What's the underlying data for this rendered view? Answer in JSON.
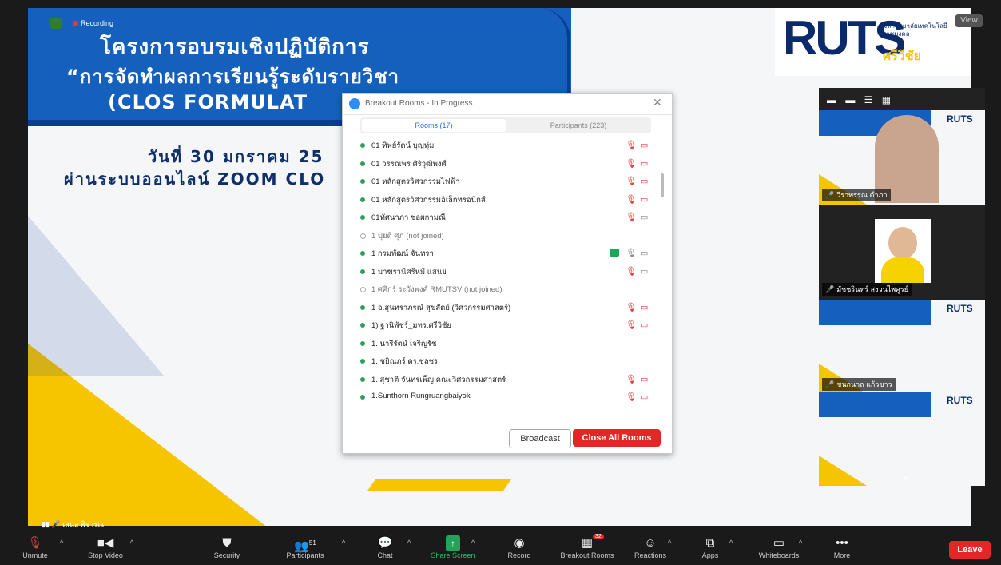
{
  "recording": "Recording",
  "slide": {
    "line1": "โครงการอบรมเชิงปฏิบัติการ",
    "line2": "“การจัดทำผลการเรียนรู้ระดับรายวิชา",
    "line3": "(CLOS FORMULAT",
    "date1": "วันที่ 30 มกราคม 25",
    "date2": "ผ่านระบบออนไลน์ ZOOM CLO",
    "logo": "RUTS",
    "logo_sub": "มหาวิทยาลัยเทคโนโลยีราชมงคล",
    "logo_sub2": "ศรีวิชัย"
  },
  "view_button": "View",
  "dialog": {
    "title": "Breakout Rooms - In Progress",
    "tab_rooms": "Rooms (17)",
    "tab_participants": "Participants (223)",
    "rows": [
      {
        "name": "01 ทิพย์รัตน์ บุญทุ่ม",
        "state": "joined",
        "mic": "muted",
        "cam": "off"
      },
      {
        "name": "01 วรรณพร ศิริวุฒิพงศ์",
        "state": "joined",
        "mic": "muted",
        "cam": "off"
      },
      {
        "name": "01 หลักสูตรวิศวกรรมไฟฟ้า",
        "state": "joined",
        "mic": "muted",
        "cam": "off"
      },
      {
        "name": "01 หลักสูตรวิศวกรรมอิเล็กทรอนิกส์",
        "state": "joined",
        "mic": "muted",
        "cam": "off"
      },
      {
        "name": "01ทัศนาภา ช่อผกามณี",
        "state": "joined",
        "mic": "muted",
        "cam": "plain"
      },
      {
        "name": "1 ปุ่ยดี ศุภ  (not joined)",
        "state": "notjoined"
      },
      {
        "name": "1 กรมพัฒน์ จันทรา",
        "state": "joined",
        "mic": "on",
        "cam": "plain",
        "share": true
      },
      {
        "name": "1 มาฆรานีศรีหมี แสนย่",
        "state": "joined",
        "mic": "muted",
        "cam": "plain"
      },
      {
        "name": "1 ศศิกร์ ระวังพงศ์ RMUTSV  (not joined)",
        "state": "notjoined"
      },
      {
        "name": "1 อ.สุนทราภรณ์ สุขสัตย์ (วิศวกรรมศาสตร์)",
        "state": "joined",
        "mic": "muted",
        "cam": "off"
      },
      {
        "name": "1) ฐานิพัชร์_มทร.ศรีวิชัย",
        "state": "joined",
        "mic": "muted",
        "cam": "off"
      },
      {
        "name": "1. นารีรัตน์ เจริญรัช",
        "state": "joined"
      },
      {
        "name": "1. ชยิณภร์ ดร.ชลชร",
        "state": "joined"
      },
      {
        "name": "1. สุชาติ จันทรเพ็ญ คณะวิศวกรรมศาสตร์",
        "state": "joined",
        "mic": "muted",
        "cam": "off"
      },
      {
        "name": "1.Sunthorn Rungruangbaiyok",
        "state": "joined",
        "mic": "muted",
        "cam": "off"
      }
    ],
    "broadcast": "Broadcast",
    "close_all": "Close All Rooms"
  },
  "gallery": {
    "thumbs": [
      {
        "label": "วีราพรรณ ดำภา"
      },
      {
        "label": "มัชชรินทร์ สงวนไพศูรย์"
      },
      {
        "label": "ชนกนาถ แก้วขาว"
      },
      {
        "label": ""
      }
    ]
  },
  "self_label": "เสนอ พิจารณ",
  "toolbar": {
    "unmute": "Unmute",
    "stop_video": "Stop Video",
    "security": "Security",
    "participants": "Participants",
    "participants_count": "51",
    "chat": "Chat",
    "share_screen": "Share Screen",
    "record": "Record",
    "breakout_rooms": "Breakout Rooms",
    "breakout_count": "32",
    "reactions": "Reactions",
    "apps": "Apps",
    "whiteboards": "Whiteboards",
    "more": "More",
    "leave": "Leave"
  }
}
